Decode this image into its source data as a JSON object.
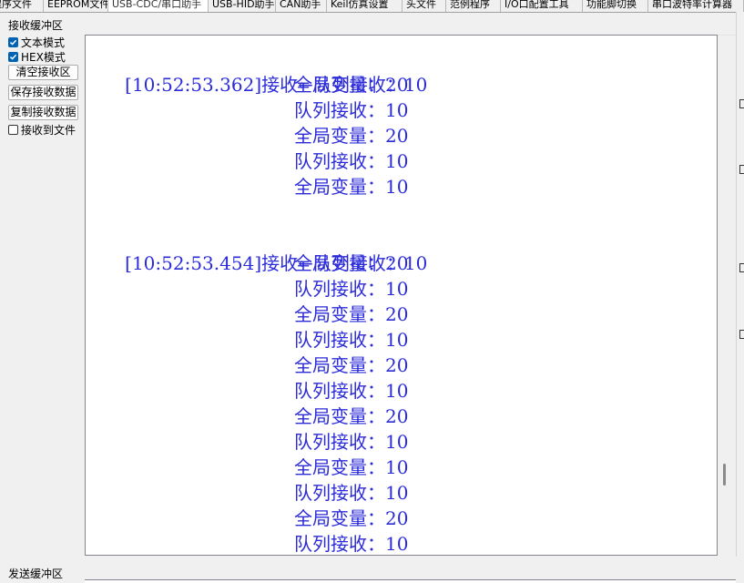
{
  "tabs": [
    {
      "label": "程序文件",
      "active": false
    },
    {
      "label": "EEPROM文件",
      "active": false
    },
    {
      "label": "USB-CDC/串口助手",
      "active": true
    },
    {
      "label": "USB-HID助手",
      "active": false
    },
    {
      "label": "CAN助手",
      "active": false
    },
    {
      "label": "Keil仿真设置",
      "active": false
    },
    {
      "label": "头文件",
      "active": false
    },
    {
      "label": "范例程序",
      "active": false
    },
    {
      "label": "I/O口配置工具",
      "active": false
    },
    {
      "label": "功能脚切换",
      "active": false
    },
    {
      "label": "串口波特率计算器",
      "active": false
    }
  ],
  "receive_panel": {
    "title": "接收缓冲区",
    "text_mode": {
      "label": "文本模式",
      "checked": true
    },
    "hex_mode": {
      "label": "HEX模式",
      "checked": true
    },
    "clear_button": "清空接收区",
    "save_button": "保存接收数据",
    "copy_button": "复制接收数据",
    "to_file": {
      "label": "接收到文件",
      "checked": false
    }
  },
  "receive_log": [
    {
      "timestamp": "[10:52:53.362]",
      "direction": "接收←",
      "text": "队列接收：10"
    },
    {
      "text": "全局变量：20"
    },
    {
      "text": "队列接收：10"
    },
    {
      "text": "全局变量：20"
    },
    {
      "text": "队列接收：10"
    },
    {
      "text": "全局变量：10"
    },
    {
      "text": ""
    },
    {
      "timestamp": "[10:52:53.454]",
      "direction": "接收←",
      "text": "队列接收：10"
    },
    {
      "text": "全局变量：20"
    },
    {
      "text": "队列接收：10"
    },
    {
      "text": "全局变量：20"
    },
    {
      "text": "队列接收：10"
    },
    {
      "text": "全局变量：20"
    },
    {
      "text": "队列接收：10"
    },
    {
      "text": "全局变量：20"
    },
    {
      "text": "队列接收：10"
    },
    {
      "text": "全局变量：10"
    },
    {
      "text": "队列接收：10"
    },
    {
      "text": "全局变量：20"
    },
    {
      "text": "队列接收：10"
    }
  ],
  "send_panel": {
    "title": "发送缓冲区"
  },
  "colors": {
    "log_text": "#2b2bd9",
    "checkbox_on": "#0063b1"
  }
}
